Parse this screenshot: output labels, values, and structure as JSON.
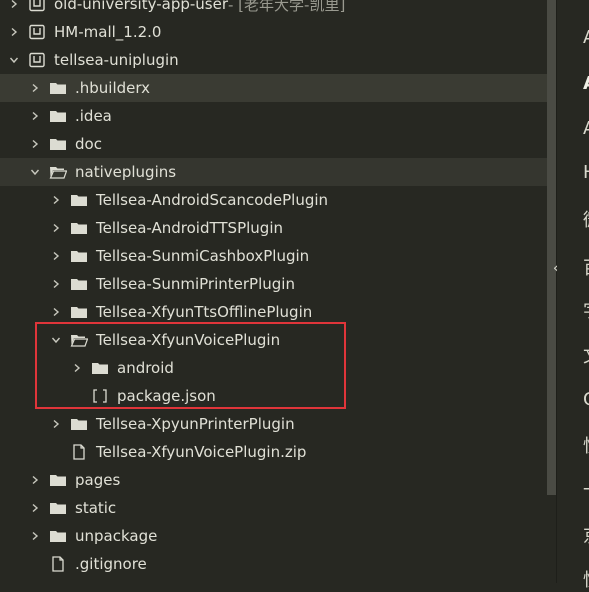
{
  "tree": [
    {
      "label": "old-university-app-user",
      "suffix": " - [老年大学-凯里]",
      "depth": 0,
      "kind": "project",
      "expanded": false
    },
    {
      "label": "HM-mall_1.2.0",
      "depth": 0,
      "kind": "project",
      "expanded": false
    },
    {
      "label": "tellsea-uniplugin",
      "depth": 0,
      "kind": "project",
      "expanded": true
    },
    {
      "label": ".hbuilderx",
      "depth": 1,
      "kind": "folder",
      "expanded": false,
      "hover": true
    },
    {
      "label": ".idea",
      "depth": 1,
      "kind": "folder",
      "expanded": false
    },
    {
      "label": "doc",
      "depth": 1,
      "kind": "folder",
      "expanded": false
    },
    {
      "label": "nativeplugins",
      "depth": 1,
      "kind": "folder",
      "expanded": true,
      "selected": true
    },
    {
      "label": "Tellsea-AndroidScancodePlugin",
      "depth": 2,
      "kind": "folder",
      "expanded": false
    },
    {
      "label": "Tellsea-AndroidTTSPlugin",
      "depth": 2,
      "kind": "folder",
      "expanded": false
    },
    {
      "label": "Tellsea-SunmiCashboxPlugin",
      "depth": 2,
      "kind": "folder",
      "expanded": false
    },
    {
      "label": "Tellsea-SunmiPrinterPlugin",
      "depth": 2,
      "kind": "folder",
      "expanded": false
    },
    {
      "label": "Tellsea-XfyunTtsOfflinePlugin",
      "depth": 2,
      "kind": "folder",
      "expanded": false
    },
    {
      "label": "Tellsea-XfyunVoicePlugin",
      "depth": 2,
      "kind": "folder",
      "expanded": true
    },
    {
      "label": "android",
      "depth": 3,
      "kind": "folder",
      "expanded": false
    },
    {
      "label": "package.json",
      "depth": 3,
      "kind": "json"
    },
    {
      "label": "Tellsea-XpyunPrinterPlugin",
      "depth": 2,
      "kind": "folder",
      "expanded": false
    },
    {
      "label": "Tellsea-XfyunVoicePlugin.zip",
      "depth": 2,
      "kind": "file"
    },
    {
      "label": "pages",
      "depth": 1,
      "kind": "folder",
      "expanded": false
    },
    {
      "label": "static",
      "depth": 1,
      "kind": "folder",
      "expanded": false
    },
    {
      "label": "unpackage",
      "depth": 1,
      "kind": "folder",
      "expanded": false
    },
    {
      "label": ".gitignore",
      "depth": 1,
      "kind": "file"
    }
  ],
  "right_panel": [
    {
      "text": "A",
      "bold": false
    },
    {
      "text": "A",
      "bold": true
    },
    {
      "text": "A",
      "bold": false
    },
    {
      "text": "H",
      "bold": false
    },
    {
      "text": "微",
      "bold": false
    },
    {
      "text": "百",
      "bold": false
    },
    {
      "text": "字",
      "bold": false
    },
    {
      "text": "文",
      "bold": false
    },
    {
      "text": "C",
      "bold": false
    },
    {
      "text": "快",
      "bold": false
    },
    {
      "text": "一",
      "bold": false
    },
    {
      "text": "京",
      "bold": false
    },
    {
      "text": "快",
      "bold": false
    }
  ],
  "collapse_glyph": "‹",
  "highlight_color": "#e0353a",
  "icons": {
    "folder": "folder-icon",
    "folder_open": "folder-open-icon",
    "project": "project-icon",
    "file": "file-icon",
    "json": "json-file-icon"
  }
}
